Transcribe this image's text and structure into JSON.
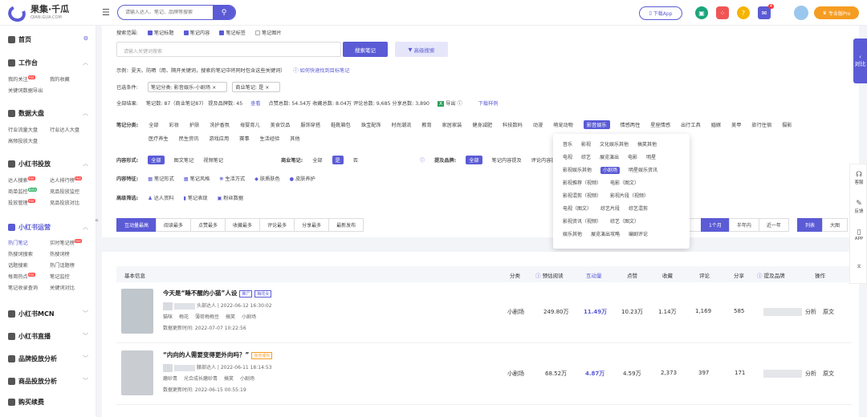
{
  "brand": {
    "name": "果集·千瓜",
    "sub": "QIAN-GUA.COM"
  },
  "search": {
    "placeholder": "请输入达人、笔记、品牌等搜索"
  },
  "topbar": {
    "download": "下载App",
    "notify_count": "4",
    "vip": "专业版Pro"
  },
  "sidebar": {
    "home": "首页",
    "workbench": {
      "title": "工作台",
      "items": [
        "我的关注",
        "我的收藏",
        "关键词数据导出"
      ]
    },
    "dashboard": {
      "title": "数据大盘",
      "items": [
        "行业流量大盘",
        "行业达人大盘",
        "高频投放大盘"
      ]
    },
    "xhs_ads": {
      "title": "小红书投放",
      "items": [
        "达人搜索",
        "达人排行榜",
        "商单监控",
        "竞品投放监控",
        "投放管理",
        "竞品投放对比"
      ]
    },
    "xhs_ops": {
      "title": "小红书运营",
      "items": [
        "热门笔记",
        "实时笔记榜",
        "热搜词搜索",
        "热搜词榜",
        "话题搜索",
        "热门话题榜",
        "每周热点",
        "笔记监控",
        "笔记收录查询",
        "关键词对比"
      ]
    },
    "mcn": "小红书MCN",
    "live": "小红书直播",
    "brand_ads": "品牌投放分析",
    "product_ads": "商品投放分析",
    "buy": "购买续费"
  },
  "filters": {
    "scope_label": "搜索范围:",
    "scope": [
      "笔记标题",
      "笔记内容",
      "笔记标签",
      "笔记图片"
    ],
    "kw_placeholder": "请输入关键词搜索",
    "kw_btn": "搜索笔记",
    "adv_btn": "高级搜索",
    "example": "示例：夏天、防晒（用、隔开关键词，搜索的笔记中将同时包含这些关键词）",
    "example_link": "如何快速找到目标笔记",
    "selected_label": "已选条件:",
    "selected": [
      "笔记分类: 影音娱乐-小剧场",
      "商业笔记: 是"
    ],
    "totals_label": "全部结果:",
    "totals": "笔记数: 87（商业笔记87）   提及品牌数: 45",
    "totals_view": "查看",
    "totals_rest": "点赞总数: 54.54万   收藏总数: 8.04万   评论总数: 9,685   分享总数: 3,890",
    "export": "导出",
    "download_log": "下载样例",
    "cat_label": "笔记分类:",
    "cats1": [
      "全部",
      "彩妆",
      "护肤",
      "洗护香氛",
      "母婴育儿",
      "美食饮品",
      "服饰穿搭",
      "鞋靴箱包",
      "珠宝配饰",
      "时尚潮流",
      "教育",
      "家居家装",
      "健身减肥",
      "科技数码",
      "动漫",
      "萌宠动物",
      "影音娱乐",
      "情感两性",
      "星座情感",
      "出行工具",
      "婚嫁",
      "美甲",
      "旅行住宿",
      "摄影"
    ],
    "cats2": [
      "医疗养生",
      "民生资讯",
      "游戏应用",
      "赛事",
      "生活经验",
      "其他"
    ],
    "form_label": "内容形式:",
    "forms": [
      "全部",
      "图文笔记",
      "视频笔记"
    ],
    "biz_label": "商业笔记:",
    "biz": [
      "全部",
      "是",
      "否"
    ],
    "brand_label": "提及品牌:",
    "brand_opts": [
      "全部",
      "笔记内容提及",
      "评论内容提及"
    ],
    "feat_label": "内容特征:",
    "feats": [
      "笔记形式",
      "笔记风格",
      "生活方式",
      "肤质肤色",
      "皮肤养护"
    ],
    "hi_label": "高级筛选:",
    "hi": [
      "达人资料",
      "笔记表现",
      "粉丝数据"
    ]
  },
  "dropdown": {
    "rows": [
      [
        "音乐",
        "影视",
        "文化娱乐其他",
        "搞笑其他"
      ],
      [
        "电视",
        "综艺",
        "展览演出",
        "电影",
        "明星"
      ],
      [
        "影视娱乐其他",
        "小剧场",
        "明星娱乐资讯"
      ],
      [
        "影视推荐（视频）",
        "电影（图文）"
      ],
      [
        "影视混剪（视频）",
        "影视片段（视频）"
      ],
      [
        "电视（图文）",
        "综艺片段",
        "综艺混剪"
      ],
      [
        "影视资讯（视频）",
        "综艺（图文）"
      ],
      [
        "娱乐其他",
        "展览演出攻略",
        "编剧评论"
      ]
    ],
    "selected": "小剧场"
  },
  "sort": {
    "tabs": [
      "互动量最高",
      "阅读最多",
      "点赞最多",
      "收藏最多",
      "评论最多",
      "分享最多",
      "最新发布"
    ],
    "time": [
      "1个月",
      "半年内",
      "近一年"
    ],
    "views": [
      "列表",
      "大图"
    ]
  },
  "table": {
    "headers": [
      "基本信息",
      "分类",
      "预估阅读",
      "互动量",
      "点赞",
      "收藏",
      "评论",
      "分享",
      "提及品牌",
      "操作"
    ],
    "rows": [
      {
        "title": "今天是“睡不醒的小猫”人设",
        "tags": [
          "推广",
          "梅花女"
        ],
        "author": "头部达人 | 2022-06-12 16:30:02",
        "keywords": [
          "猫咪",
          "梅花",
          "薄荷梅梅豆",
          "搞笑",
          "小剧场"
        ],
        "updated": "数据更新时间: 2022-07-07 10:22:56",
        "category": "小剧场",
        "reads": "249.80万",
        "interact": "11.49万",
        "likes": "10.23万",
        "fav": "1.14万",
        "comments": "1,169",
        "shares": "585",
        "act1": "分析",
        "act2": "原文"
      },
      {
        "title": "“内向的人需要变得更外向吗？”",
        "tags": [
          "完全成长"
        ],
        "author": "腰部达人 | 2022-06-11 18:14:53",
        "keywords": [
          "磨砂青",
          "光合成长磨砂青",
          "搞笑",
          "小剧场"
        ],
        "updated": "数据更新时间: 2022-06-15 00:55:19",
        "category": "小剧场",
        "reads": "68.52万",
        "interact": "4.87万",
        "likes": "4.59万",
        "fav": "2,373",
        "comments": "397",
        "shares": "171",
        "act1": "分析",
        "act2": "原文"
      }
    ]
  },
  "right": {
    "compare": "对比",
    "service": "客服",
    "feedback": "反馈",
    "app": "APP"
  }
}
